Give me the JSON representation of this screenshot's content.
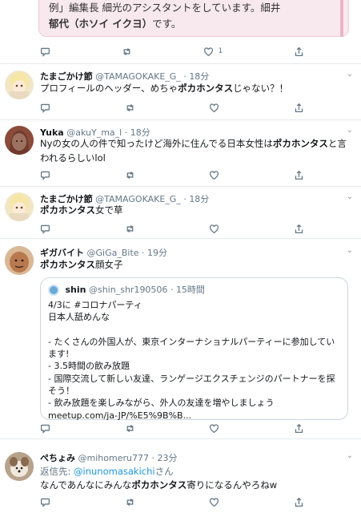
{
  "top_card": {
    "line1": "例」編集長 細光のアシスタントをしています。細井",
    "line2_plain": "郁代（ホソイ イクヨ）",
    "line2_suffix": "です。"
  },
  "top_actions": {
    "likes": "1"
  },
  "tweets": [
    {
      "name": "たまごかけ節",
      "handle": "@TAMAGOKAKE_G_",
      "dot": "·",
      "time": "18分",
      "text_before": "プロフィールのヘッダー、めちゃ",
      "text_bold": "ポカホンタス",
      "text_after": "じゃない？！"
    },
    {
      "name": "Yuka",
      "handle": "@akuY_ma_l",
      "dot": "·",
      "time": "18分",
      "text_before": "Nyの女の人の件で知ったけど海外に住んでる日本女性は",
      "text_bold": "ポカホンタス",
      "text_after": "と言われるらしいlol"
    },
    {
      "name": "たまごかけ節",
      "handle": "@TAMAGOKAKE_G_",
      "dot": "·",
      "time": "18分",
      "text_before": "",
      "text_bold": "ポカホンタス",
      "text_after": "女で草"
    },
    {
      "name": "ギガバイト",
      "handle": "@GiGa_Bite",
      "dot": "·",
      "time": "19分",
      "text_before": "",
      "text_bold": "ポカホンタス",
      "text_after": "顔女子",
      "quote": {
        "name": "shin",
        "handle": "@shin_shr190506",
        "dot": "·",
        "time": "15時間",
        "lines": [
          "4/3に #コロナパーティ",
          "日本人舐めんな",
          "",
          "- たくさんの外国人が、東京インターナショナルパーティーに参加しています!",
          "- 3.5時間の飲み放題",
          "- 国際交流して新しい友達、ランゲージエクスチェンジのパートナーを探そう！",
          "- 飲み放題を楽しみながら、外人の友達を増やしましょう",
          "meetup.com/ja-JP/%E5%9B%B..."
        ]
      }
    },
    {
      "name": "ぺちょみ",
      "handle": "@mihomeru777",
      "dot": "·",
      "time": "23分",
      "reply_prefix": "返信先:",
      "reply_to": "@inunomasakichi",
      "reply_suffix": "さん",
      "text_before": "なんであんなにみんな",
      "text_bold": "ポカホンタス",
      "text_after": "寄りになるんやろねw"
    }
  ],
  "icons": [
    "reply-icon",
    "retweet-icon",
    "like-icon",
    "share-icon",
    "chevron-down-icon"
  ]
}
